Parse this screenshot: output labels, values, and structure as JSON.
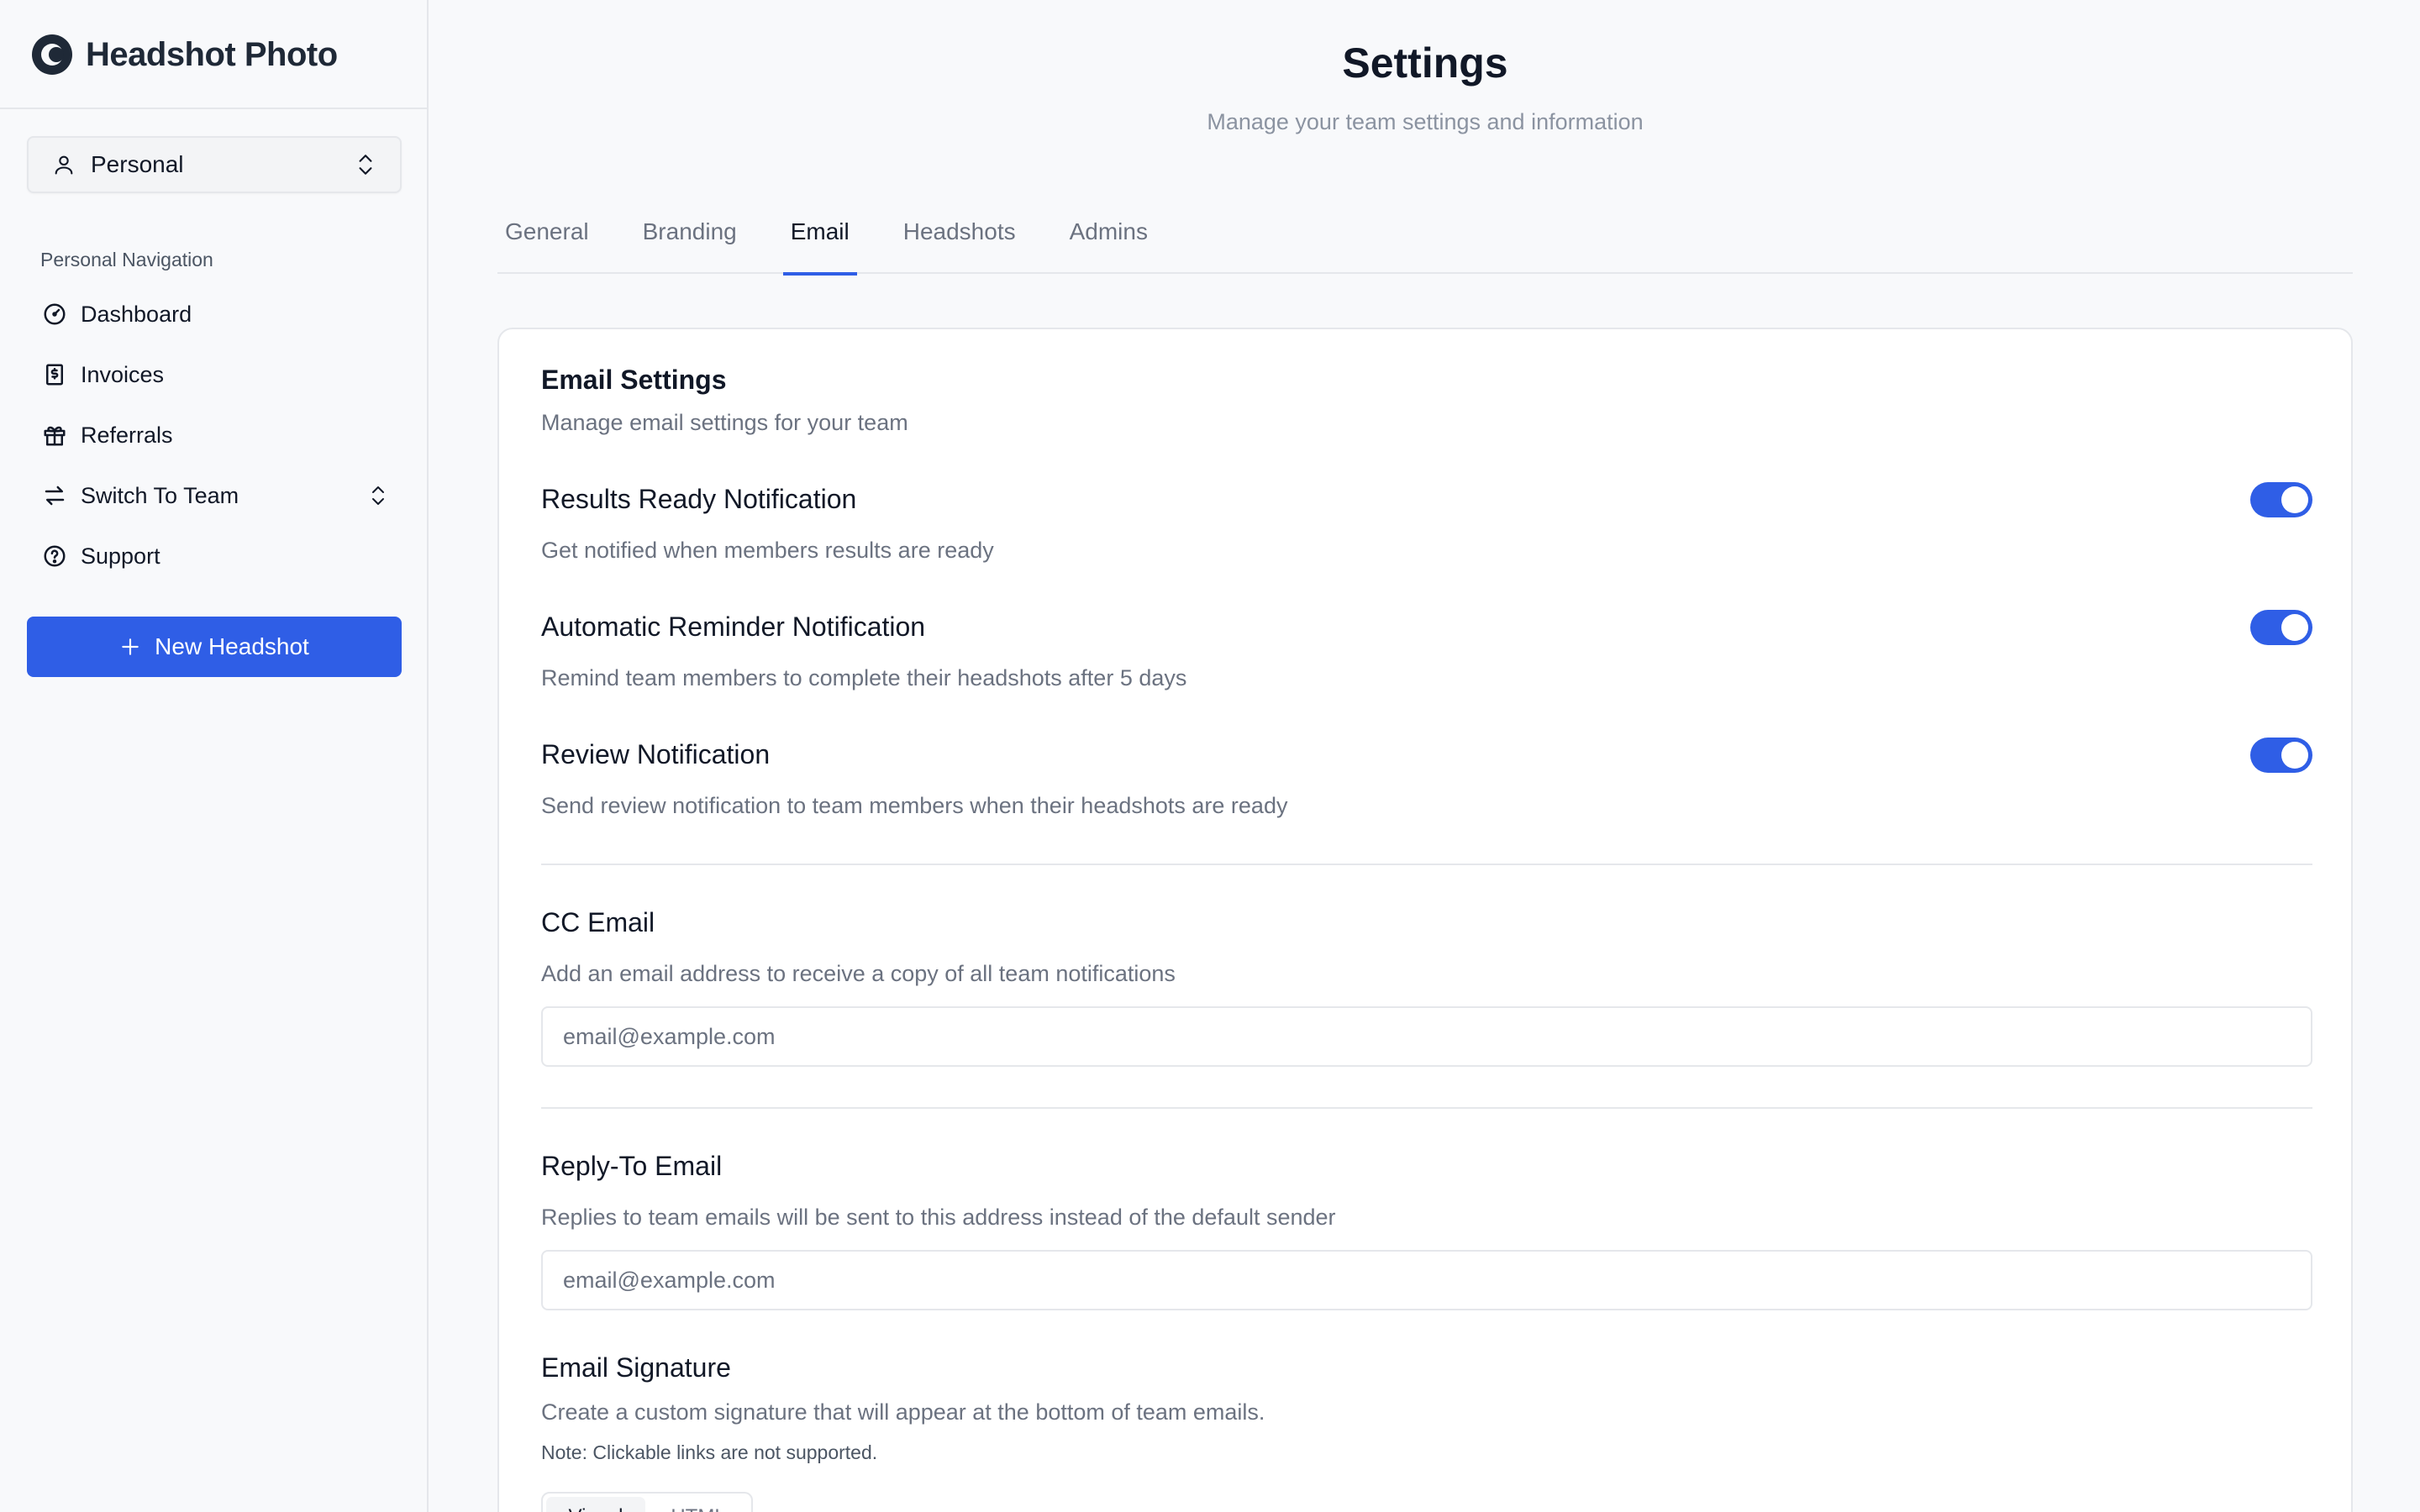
{
  "brand": {
    "name": "Headshot Photo",
    "accent": "#2f5ee6"
  },
  "sidebar": {
    "workspace": {
      "label": "Personal",
      "icon": "user-icon"
    },
    "nav_heading": "Personal Navigation",
    "items": [
      {
        "label": "Dashboard",
        "icon": "gauge-icon"
      },
      {
        "label": "Invoices",
        "icon": "receipt-icon"
      },
      {
        "label": "Referrals",
        "icon": "gift-icon"
      },
      {
        "label": "Switch To Team",
        "icon": "swap-icon"
      },
      {
        "label": "Support",
        "icon": "help-circle-icon"
      }
    ],
    "new_button": "New Headshot"
  },
  "header": {
    "title": "Settings",
    "subtitle": "Manage your team settings and information"
  },
  "tabs": [
    {
      "label": "General",
      "active": false
    },
    {
      "label": "Branding",
      "active": false
    },
    {
      "label": "Email",
      "active": true
    },
    {
      "label": "Headshots",
      "active": false
    },
    {
      "label": "Admins",
      "active": false
    }
  ],
  "email_settings": {
    "title": "Email Settings",
    "subtitle": "Manage email settings for your team",
    "toggles": [
      {
        "title": "Results Ready Notification",
        "desc": "Get notified when members results are ready",
        "on": true
      },
      {
        "title": "Automatic Reminder Notification",
        "desc": "Remind team members to complete their headshots after 5 days",
        "on": true
      },
      {
        "title": "Review Notification",
        "desc": "Send review notification to team members when their headshots are ready",
        "on": true
      }
    ],
    "cc_email": {
      "title": "CC Email",
      "desc": "Add an email address to receive a copy of all team notifications",
      "placeholder": "email@example.com",
      "value": ""
    },
    "reply_to": {
      "title": "Reply-To Email",
      "desc": "Replies to team emails will be sent to this address instead of the default sender",
      "placeholder": "email@example.com",
      "value": ""
    },
    "signature": {
      "title": "Email Signature",
      "desc": "Create a custom signature that will appear at the bottom of team emails.",
      "note": "Note: Clickable links are not supported.",
      "modes": [
        "Visual",
        "HTML"
      ],
      "active_mode": "Visual"
    }
  }
}
